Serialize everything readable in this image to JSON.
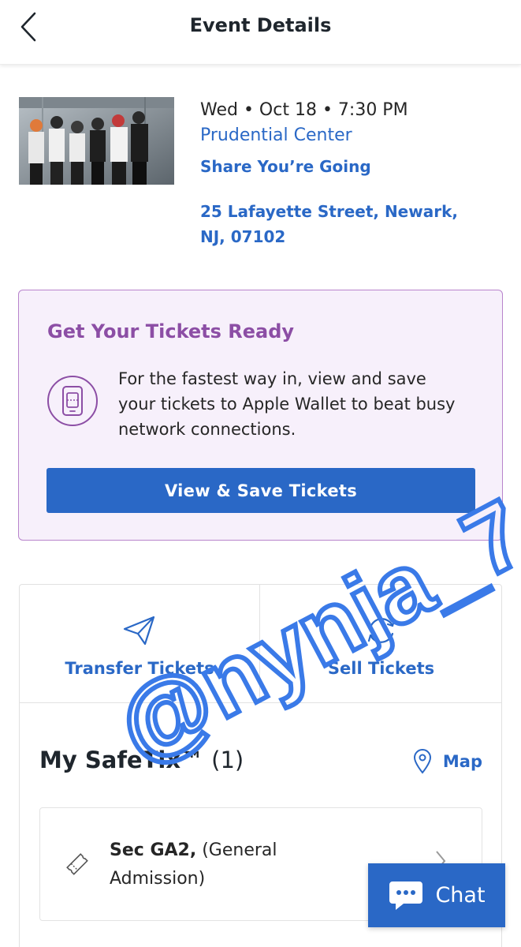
{
  "header": {
    "title": "Event Details",
    "back_icon": "chevron-left-icon"
  },
  "event": {
    "date": "Wed • Oct 18 • 7:30 PM",
    "venue": "Prudential Center",
    "share": "Share You’re Going",
    "address": "25 Lafayette Street, Newark, NJ, 07102"
  },
  "promo": {
    "title": "Get Your Tickets Ready",
    "text": "For the fastest way in, view and save your tickets to Apple Wallet to beat busy network connections.",
    "button": "View & Save Tickets",
    "icon": "phone-ticket-icon"
  },
  "actions": {
    "transfer": "Transfer Tickets",
    "sell": "Sell Tickets"
  },
  "safetix": {
    "title": "My SafeTix™",
    "count": "(1)",
    "map": "Map"
  },
  "ticket": {
    "section": "Sec GA2,",
    "type": "(General Admission)"
  },
  "watermark": "@nynja_7",
  "chat": {
    "label": "Chat"
  },
  "colors": {
    "accent": "#2a68c6",
    "promo_purple": "#8c4ea5",
    "promo_bg": "#f7f0fb"
  }
}
